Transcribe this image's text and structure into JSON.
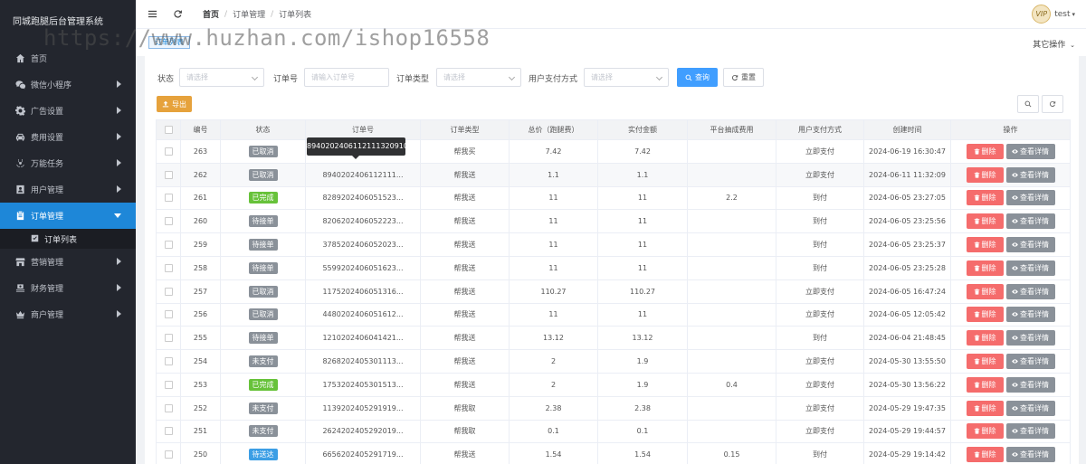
{
  "app": {
    "title": "同城跑腿后台管理系统"
  },
  "sidebar": {
    "items": [
      {
        "label": "首页",
        "icon": "home-icon"
      },
      {
        "label": "微信小程序",
        "icon": "wechat-icon"
      },
      {
        "label": "广告设置",
        "icon": "settings-icon"
      },
      {
        "label": "费用设置",
        "icon": "car-icon"
      },
      {
        "label": "万能任务",
        "icon": "biohazard-icon"
      },
      {
        "label": "用户管理",
        "icon": "user-card-icon"
      },
      {
        "label": "订单管理",
        "icon": "clipboard-icon"
      },
      {
        "label": "营销管理",
        "icon": "shop-icon"
      },
      {
        "label": "财务管理",
        "icon": "money-icon"
      },
      {
        "label": "商户管理",
        "icon": "crown-icon"
      }
    ],
    "sub_item": {
      "label": "订单列表",
      "icon": "checkbox-icon"
    }
  },
  "breadcrumb": {
    "home": "首页",
    "section": "订单管理",
    "page": "订单列表"
  },
  "user": {
    "name": "test",
    "avatar_text": "VIP"
  },
  "tabs": {
    "active": "订单列表",
    "other_ops": "其它操作"
  },
  "filters": {
    "status_label": "状态",
    "status_placeholder": "请选择",
    "order_no_label": "订单号",
    "order_no_placeholder": "请输入订单号",
    "order_type_label": "订单类型",
    "order_type_placeholder": "请选择",
    "payment_label": "用户支付方式",
    "payment_placeholder": "请选择",
    "query_btn": "查询",
    "reset_btn": "重置"
  },
  "toolbar": {
    "export_btn": "导出"
  },
  "table": {
    "columns": [
      "编号",
      "状态",
      "订单号",
      "订单类型",
      "总价（跑腿费）",
      "实付金额",
      "平台抽成费用",
      "用户支付方式",
      "创建时间",
      "操作"
    ],
    "delete_label": "删除",
    "view_label": "查看详情",
    "rows": [
      {
        "id": "263",
        "status": "已取消",
        "status_color": "#8a9199",
        "order_no": "",
        "type": "帮我买",
        "total": "7.42",
        "paid": "7.42",
        "fee": "",
        "payment": "立即支付",
        "created": "2024-06-19 16:30:47"
      },
      {
        "id": "262",
        "status": "已取消",
        "status_color": "#8a9199",
        "order_no": "8940202406112111...",
        "type": "帮我送",
        "total": "1.1",
        "paid": "1.1",
        "fee": "",
        "payment": "立即支付",
        "created": "2024-06-11 11:32:09"
      },
      {
        "id": "261",
        "status": "已完成",
        "status_color": "#67c23a",
        "order_no": "8289202406051523...",
        "type": "帮我送",
        "total": "11",
        "paid": "11",
        "fee": "2.2",
        "payment": "到付",
        "created": "2024-06-05 23:27:05"
      },
      {
        "id": "260",
        "status": "待接单",
        "status_color": "#8a9199",
        "order_no": "8206202406052223...",
        "type": "帮我送",
        "total": "11",
        "paid": "11",
        "fee": "",
        "payment": "到付",
        "created": "2024-06-05 23:25:56"
      },
      {
        "id": "259",
        "status": "待接单",
        "status_color": "#8a9199",
        "order_no": "3785202406052023...",
        "type": "帮我送",
        "total": "11",
        "paid": "11",
        "fee": "",
        "payment": "到付",
        "created": "2024-06-05 23:25:37"
      },
      {
        "id": "258",
        "status": "待接单",
        "status_color": "#8a9199",
        "order_no": "5599202406051623...",
        "type": "帮我送",
        "total": "11",
        "paid": "11",
        "fee": "",
        "payment": "到付",
        "created": "2024-06-05 23:25:28"
      },
      {
        "id": "257",
        "status": "已取消",
        "status_color": "#8a9199",
        "order_no": "1175202406051316...",
        "type": "帮我送",
        "total": "110.27",
        "paid": "110.27",
        "fee": "",
        "payment": "立即支付",
        "created": "2024-06-05 16:47:24"
      },
      {
        "id": "256",
        "status": "已取消",
        "status_color": "#8a9199",
        "order_no": "4480202406051612...",
        "type": "帮我送",
        "total": "11",
        "paid": "11",
        "fee": "",
        "payment": "立即支付",
        "created": "2024-06-05 12:05:42"
      },
      {
        "id": "255",
        "status": "待接单",
        "status_color": "#8a9199",
        "order_no": "1210202406041421...",
        "type": "帮我送",
        "total": "13.12",
        "paid": "13.12",
        "fee": "",
        "payment": "到付",
        "created": "2024-06-04 21:48:45"
      },
      {
        "id": "254",
        "status": "未支付",
        "status_color": "#8a9199",
        "order_no": "8268202405301113...",
        "type": "帮我送",
        "total": "2",
        "paid": "1.9",
        "fee": "",
        "payment": "立即支付",
        "created": "2024-05-30 13:55:50"
      },
      {
        "id": "253",
        "status": "已完成",
        "status_color": "#67c23a",
        "order_no": "1753202405301513...",
        "type": "帮我送",
        "total": "2",
        "paid": "1.9",
        "fee": "0.4",
        "payment": "立即支付",
        "created": "2024-05-30 13:56:22"
      },
      {
        "id": "252",
        "status": "未支付",
        "status_color": "#8a9199",
        "order_no": "1139202405291919...",
        "type": "帮我取",
        "total": "2.38",
        "paid": "2.38",
        "fee": "",
        "payment": "立即支付",
        "created": "2024-05-29 19:47:35"
      },
      {
        "id": "251",
        "status": "未支付",
        "status_color": "#8a9199",
        "order_no": "2624202405292019...",
        "type": "帮我取",
        "total": "0.1",
        "paid": "0.1",
        "fee": "",
        "payment": "立即支付",
        "created": "2024-05-29 19:44:57"
      },
      {
        "id": "250",
        "status": "待送达",
        "status_color": "#3c9ee5",
        "order_no": "6656202405291719...",
        "type": "帮我送",
        "total": "1.54",
        "paid": "1.54",
        "fee": "0.15",
        "payment": "到付",
        "created": "2024-05-29 19:14:42"
      }
    ]
  },
  "tooltip": {
    "text": "8940202406112111320910"
  },
  "watermark": {
    "text": "https://www.huzhan.com/ishop16558"
  }
}
